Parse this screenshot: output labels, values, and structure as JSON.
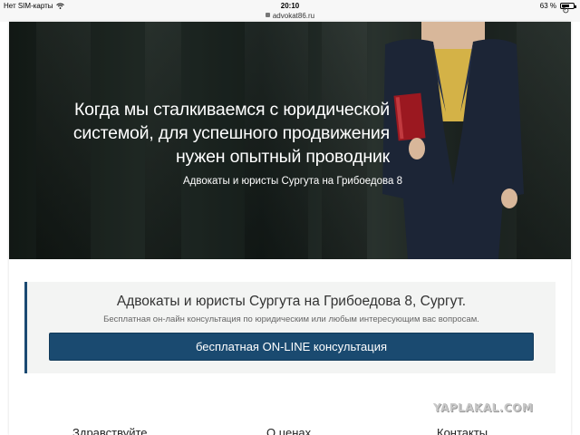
{
  "status_bar": {
    "carrier": "Нет SIM-карты",
    "time": "20:10",
    "battery_text": "63 %",
    "battery_level": 0.63,
    "url": "advokat86.ru"
  },
  "hero": {
    "title_lines": [
      "Когда мы сталкиваемся с юридической",
      "системой, для успешного продвижения",
      "нужен опытный проводник"
    ],
    "subtitle": "Адвокаты и юристы  Сургута на  Грибоедова 8"
  },
  "info": {
    "title": "Адвокаты и юристы Сургута на Грибоедова 8, Сургут.",
    "subtitle": "Бесплатная он-лайн консультация по юридическим или любым интересующим вас вопросам.",
    "button_label": "бесплатная ON-LINE консультация"
  },
  "watermark": "YAPLAKAL.COM",
  "bottom_nav": [
    "Здравствуйте",
    "О ценах",
    "Контакты"
  ],
  "colors": {
    "accent": "#1a4a70",
    "info_bg": "#f3f4f3"
  }
}
